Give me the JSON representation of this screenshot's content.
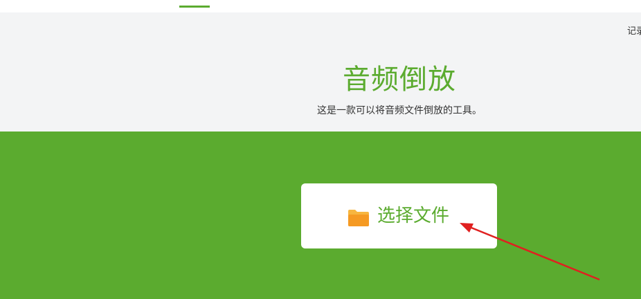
{
  "nav": {
    "corner_link": "记录"
  },
  "hero": {
    "title": "音频倒放",
    "subtitle": "这是一款可以将音频文件倒放的工具。"
  },
  "upload": {
    "button_label": "选择文件",
    "icon": "folder-icon"
  },
  "colors": {
    "accent": "#5bab2f",
    "hero_bg": "#f3f4f5",
    "annotation": "#e02020",
    "folder": "#f5a623"
  }
}
